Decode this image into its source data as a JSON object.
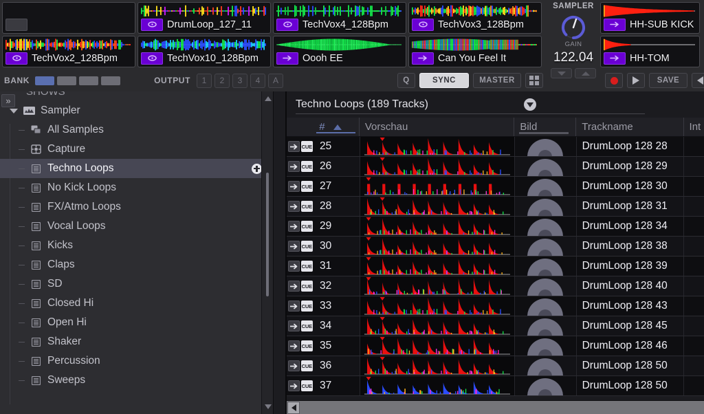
{
  "deck": {
    "slots": [
      {
        "name": "",
        "empty": true,
        "badge": "loop-icon",
        "wave": "none"
      },
      {
        "name": "DrumLoop_127_11",
        "empty": false,
        "badge": "loop-icon",
        "wave": "multicolor-sparse"
      },
      {
        "name": "TechVox4_128Bpm",
        "empty": false,
        "badge": "loop-icon",
        "wave": "green-blocks"
      },
      {
        "name": "TechVox3_128Bpm",
        "empty": false,
        "badge": "loop-icon",
        "wave": "rainbow-dense"
      },
      {
        "name": "HH-SUB KICK",
        "empty": false,
        "badge": "oneshot-icon",
        "wave": "red-decay"
      },
      {
        "name": "TechVox2_128Bpm",
        "empty": false,
        "badge": "loop-icon",
        "wave": "rainbow-mid"
      },
      {
        "name": "TechVox10_128Bpm",
        "empty": false,
        "badge": "loop-icon",
        "wave": "blue-green"
      },
      {
        "name": "Oooh EE",
        "empty": false,
        "badge": "oneshot-icon",
        "wave": "green-swell"
      },
      {
        "name": "Can You Feel It",
        "empty": false,
        "badge": "oneshot-icon",
        "wave": "green-blue-swell"
      },
      {
        "name": "HH-TOM",
        "empty": false,
        "badge": "oneshot-icon",
        "wave": "red-short-decay"
      }
    ],
    "sampler": {
      "title": "SAMPLER",
      "knob_label": "GAIN",
      "bpm": "122.04",
      "down_label": "▼",
      "up_label": "▲",
      "knob_color": "#5b5bd6"
    },
    "bar": {
      "bank_label": "BANK",
      "bank_slots": [
        true,
        false,
        false,
        false
      ],
      "output_label": "OUTPUT",
      "output_buttons": [
        "1",
        "2",
        "3",
        "4",
        "A"
      ],
      "q_label": "Q",
      "sync_label": "SYNC",
      "sync_active": true,
      "master_label": "MASTER",
      "grid_label": "grid-icon",
      "record_label": "record-icon",
      "play_label": "play-icon",
      "save_label": "SAVE",
      "collapse_label": "collapse-icon",
      "active_color": "#5a6fb0"
    }
  },
  "sidebar": {
    "cut_row_label": "SHOWS",
    "expand_label": "»",
    "parent": {
      "label": "Sampler",
      "icon": "sampler-icon"
    },
    "items": [
      {
        "label": "All Samples",
        "icon": "all-samples-icon",
        "selected": false
      },
      {
        "label": "Capture",
        "icon": "capture-icon",
        "selected": false
      },
      {
        "label": "Techno Loops",
        "icon": "playlist-icon",
        "selected": true,
        "badge": "add-icon"
      },
      {
        "label": "No Kick Loops",
        "icon": "playlist-icon",
        "selected": false
      },
      {
        "label": "FX/Atmo Loops",
        "icon": "playlist-icon",
        "selected": false
      },
      {
        "label": "Vocal Loops",
        "icon": "playlist-icon",
        "selected": false
      },
      {
        "label": "Kicks",
        "icon": "playlist-icon",
        "selected": false
      },
      {
        "label": "Claps",
        "icon": "playlist-icon",
        "selected": false
      },
      {
        "label": "SD",
        "icon": "playlist-icon",
        "selected": false
      },
      {
        "label": "Closed Hi",
        "icon": "playlist-icon",
        "selected": false
      },
      {
        "label": "Open Hi",
        "icon": "playlist-icon",
        "selected": false
      },
      {
        "label": "Shaker",
        "icon": "playlist-icon",
        "selected": false
      },
      {
        "label": "Percussion",
        "icon": "playlist-icon",
        "selected": false
      },
      {
        "label": "Sweeps",
        "icon": "playlist-icon",
        "selected": false
      }
    ]
  },
  "tracklist": {
    "title": "Techno Loops (189 Tracks)",
    "filter_icon": "filter-icon",
    "columns": [
      {
        "key": "cue",
        "label": ""
      },
      {
        "key": "num",
        "label": "#",
        "sorted": "asc"
      },
      {
        "key": "preview",
        "label": "Vorschau"
      },
      {
        "key": "bild",
        "label": "Bild"
      },
      {
        "key": "name",
        "label": "Trackname"
      },
      {
        "key": "int",
        "label": "Int"
      }
    ],
    "cue_label": "CUE",
    "rows": [
      {
        "num": "25",
        "name": "DrumLoop 128 28",
        "wave": "red-kicks-a"
      },
      {
        "num": "26",
        "name": "DrumLoop 128 29",
        "wave": "red-kicks-a"
      },
      {
        "num": "27",
        "name": "DrumLoop 128 30",
        "wave": "red-spikes"
      },
      {
        "num": "28",
        "name": "DrumLoop 128 31",
        "wave": "red-kicks-b"
      },
      {
        "num": "29",
        "name": "DrumLoop 128 34",
        "wave": "red-kicks-c"
      },
      {
        "num": "30",
        "name": "DrumLoop 128 38",
        "wave": "red-kicks-c"
      },
      {
        "num": "31",
        "name": "DrumLoop 128 39",
        "wave": "red-kicks-c"
      },
      {
        "num": "32",
        "name": "DrumLoop 128 40",
        "wave": "red-kicks-d"
      },
      {
        "num": "33",
        "name": "DrumLoop 128 43",
        "wave": "red-kicks-a"
      },
      {
        "num": "34",
        "name": "DrumLoop 128 45",
        "wave": "red-kicks-b"
      },
      {
        "num": "35",
        "name": "DrumLoop 128 46",
        "wave": "red-green-kicks"
      },
      {
        "num": "36",
        "name": "DrumLoop 128 50",
        "wave": "red-kicks-b"
      },
      {
        "num": "37",
        "name": "DrumLoop 128 50",
        "wave": "blue-kicks"
      }
    ],
    "scroll_left_label": "◀"
  }
}
